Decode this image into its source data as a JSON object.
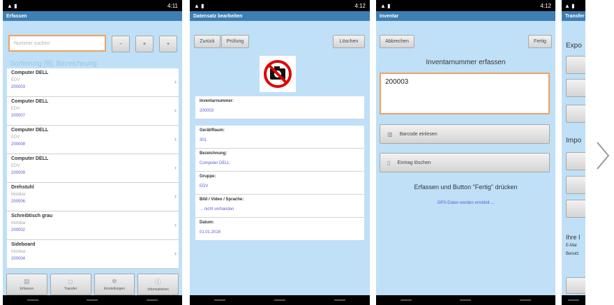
{
  "status": {
    "p1_time": "4:11",
    "p2_time": "4:12",
    "p3_time": "4:12"
  },
  "phone1": {
    "title": "Erfassen",
    "search_placeholder": "Nummer suchen",
    "sort_label": "Sortierung [B]: Bezeichnung",
    "items": [
      {
        "name": "Computer DELL",
        "group": "EDV",
        "number": "200003"
      },
      {
        "name": "Computer DELL",
        "group": "EDV",
        "number": "200007"
      },
      {
        "name": "Computer DELL",
        "group": "EDV",
        "number": "200008"
      },
      {
        "name": "Computer DELL",
        "group": "EDV",
        "number": "200009"
      },
      {
        "name": "Drehstuhl",
        "group": "Mobiliar",
        "number": "200006"
      },
      {
        "name": "Schreibtisch grau",
        "group": "Mobiliar",
        "number": "200002"
      },
      {
        "name": "Sideboard",
        "group": "Mobiliar",
        "number": "200004"
      }
    ],
    "tabs": [
      "Erfassen",
      "Transfer",
      "Einstellungen",
      "Informationen"
    ]
  },
  "phone2": {
    "title": "Datensatz bearbeiten",
    "btn_back": "Zurück",
    "btn_check": "Prüfung",
    "btn_delete": "Löschen",
    "fields": [
      {
        "label": "Inventarnummer:",
        "value": "200003"
      },
      {
        "label": "Gerät/Raum:",
        "value": "301"
      },
      {
        "label": "Bezeichnung:",
        "value": "Computer DELL"
      },
      {
        "label": "Gruppe:",
        "value": "EDV"
      },
      {
        "label": "Bild / Video / Sprache:",
        "value": "... nicht vorhanden"
      },
      {
        "label": "Datum:",
        "value": "01.01.2016"
      }
    ]
  },
  "phone3": {
    "title": "Inventar",
    "btn_cancel": "Abbrechen",
    "btn_done": "Fertig",
    "heading": "Inventarnummer erfassen",
    "input_value": "200003",
    "btn_barcode": "Barcode einlesen",
    "btn_delete_entry": "Eintrag löschen",
    "instruction": "Erfassen und Button \"Fertig\" drücken",
    "gps_text": "GPS-Daten werden ermittelt ..."
  },
  "phone4": {
    "title": "Transfer",
    "export_label": "Expo",
    "import_label": "Impo",
    "footer_line1": "Ihre I",
    "footer_line2": "E-Mai",
    "footer_line3": "Benutz"
  },
  "colors": {
    "phone_bg": "#bfe0f7",
    "title_bar": "#3d7fb5",
    "link_blue": "#5b5bd6",
    "accent_orange": "#f0a060"
  }
}
